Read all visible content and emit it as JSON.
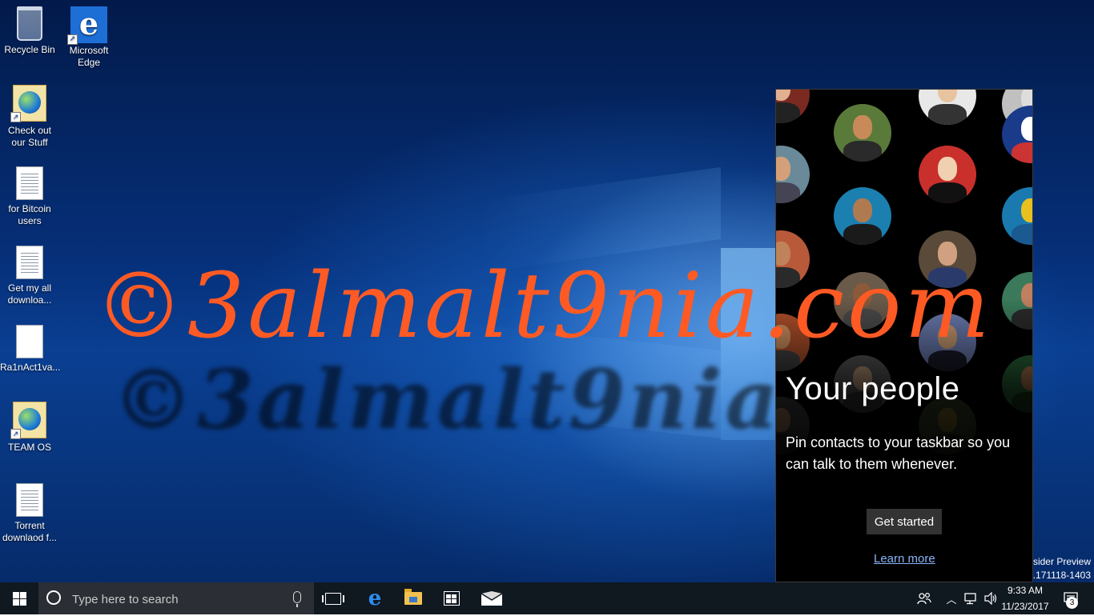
{
  "desktop": {
    "icons": [
      {
        "label": "Recycle Bin",
        "icon": "recycle-bin-icon"
      },
      {
        "label": "Microsoft Edge",
        "icon": "edge-icon"
      },
      {
        "label": "Check out our Stuff",
        "icon": "web-shortcut-icon"
      },
      {
        "label": "for Bitcoin users",
        "icon": "text-document-icon"
      },
      {
        "label": "Get my all downloa...",
        "icon": "text-document-icon"
      },
      {
        "label": "Ra1nAct1va...",
        "icon": "blank-document-icon"
      },
      {
        "label": "TEAM OS",
        "icon": "web-shortcut-icon"
      },
      {
        "label": "Torrent downlaod f...",
        "icon": "text-document-icon"
      }
    ],
    "watermark": "©3almalt9nia.com",
    "watermark_shadow": "©3almalt9nia.com",
    "insider_line1": "nsider Preview",
    "insider_line2": "e.171118-1403"
  },
  "people_panel": {
    "title": "Your people",
    "description": "Pin contacts to your taskbar so you can talk to them whenever.",
    "get_started_label": "Get started",
    "learn_more_label": "Learn more"
  },
  "taskbar": {
    "search_placeholder": "Type here to search",
    "pinned": [
      "task-view-icon",
      "edge-icon",
      "file-explorer-icon",
      "store-icon",
      "mail-icon"
    ],
    "clock_time": "9:33 AM",
    "clock_date": "11/23/2017",
    "notification_count": "3"
  },
  "colors": {
    "watermark": "#ff5a24",
    "link": "#8ab4f8",
    "taskbar": "#101820",
    "search_box": "#2b2f35"
  }
}
